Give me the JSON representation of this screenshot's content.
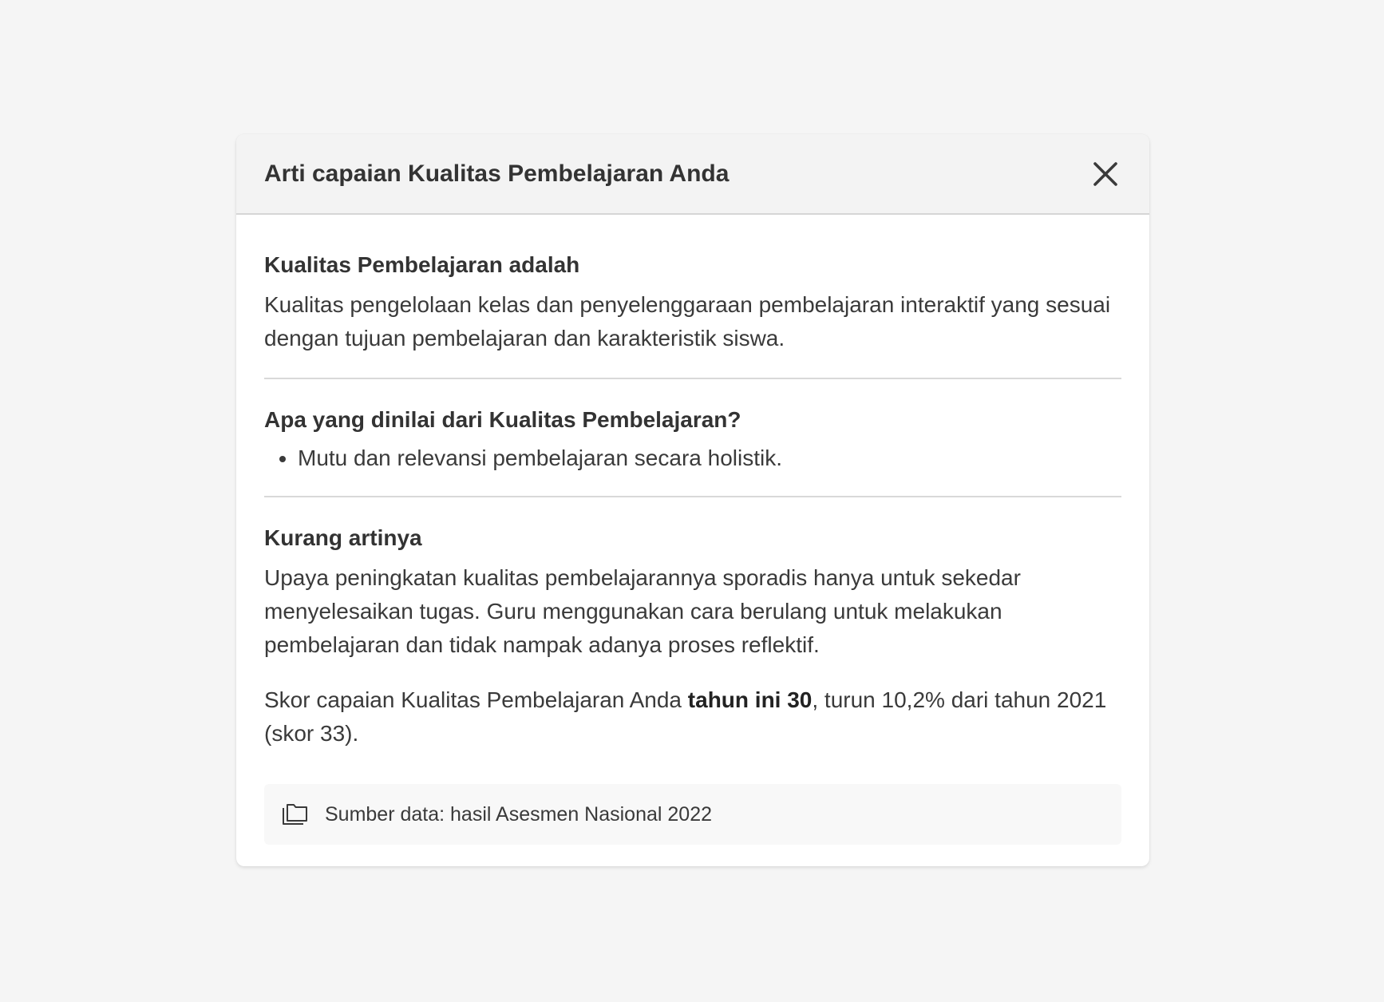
{
  "modal": {
    "title": "Arti capaian Kualitas Pembelajaran Anda",
    "close_icon": "close-icon"
  },
  "sections": {
    "definition": {
      "title": "Kualitas Pembelajaran adalah",
      "text": "Kualitas pengelolaan kelas dan penyelenggaraan pembelajaran interaktif yang sesuai dengan tujuan pembelajaran dan karakteristik siswa."
    },
    "assessed": {
      "title": "Apa yang dinilai dari Kualitas Pembelajaran?",
      "items": [
        "Mutu dan relevansi pembelajaran secara holistik."
      ]
    },
    "result": {
      "title": "Kurang artinya",
      "text": "Upaya peningkatan kualitas pembelajarannya sporadis hanya untuk sekedar menyelesaikan tugas. Guru menggunakan cara berulang untuk melakukan pembelajaran dan tidak nampak adanya proses reflektif.",
      "score_prefix": "Skor capaian Kualitas Pembelajaran Anda ",
      "score_highlight": "tahun ini 30",
      "score_suffix": ", turun 10,2% dari tahun 2021 (skor 33)."
    }
  },
  "source": {
    "icon": "folder-icon",
    "text": "Sumber data: hasil Asesmen Nasional 2022"
  }
}
